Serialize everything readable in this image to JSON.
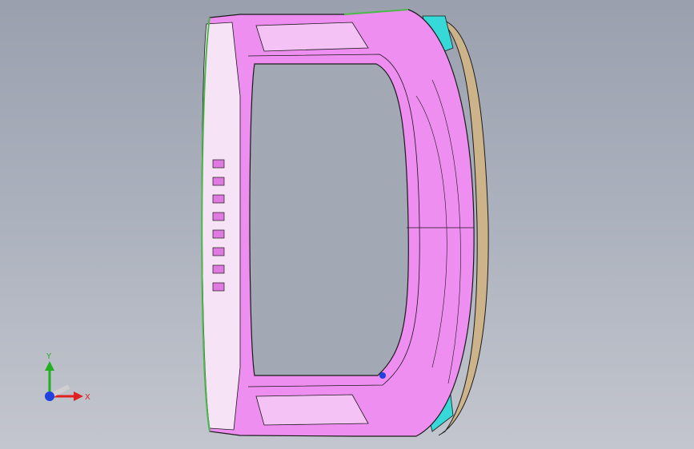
{
  "viewport": {
    "background_top": "#9aa0ad",
    "background_bottom": "#c3c6ce"
  },
  "model": {
    "part_color": "#ee8ef0",
    "edge_color": "#1a1a1a",
    "inner_color": "#f4c2f4",
    "trim_color": "#cdb38a",
    "bracket_color": "#36d8d8",
    "seal_color": "#4cb84c"
  },
  "triad": {
    "x_label": "X",
    "y_label": "Y",
    "x_color": "#e02020",
    "y_color": "#20b020",
    "z_color": "#2040e0"
  }
}
